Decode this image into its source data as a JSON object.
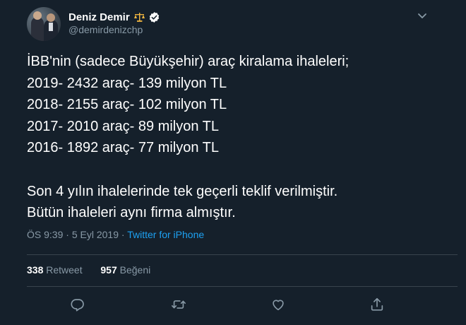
{
  "tweet": {
    "display_name": "Deniz Demir",
    "handle": "@demirdenizchp",
    "text_lines": [
      "İBB'nin (sadece Büyükşehir) araç kiralama ihaleleri;",
      "2019- 2432 araç- 139 milyon TL",
      "2018- 2155 araç- 102 milyon TL",
      "2017- 2010 araç- 89 milyon TL",
      "2016- 1892 araç- 77 milyon TL",
      "Son 4 yılın ihalelerinde tek geçerli teklif verilmiştir.",
      "Bütün ihaleleri aynı firma almıştır."
    ],
    "time": "ÖS 9:39",
    "separator": "·",
    "date": "5 Eyl 2019",
    "source": "Twitter for iPhone",
    "retweet_count": "338",
    "retweet_label": "Retweet",
    "like_count": "957",
    "like_label": "Beğeni"
  },
  "icons": {
    "name_badge": "scale-icon",
    "verified": "verified-badge-icon",
    "menu": "chevron-down-icon",
    "reply": "reply-icon",
    "retweet": "retweet-icon",
    "like": "heart-icon",
    "share": "share-icon"
  },
  "colors": {
    "background": "#15202b",
    "primary_text": "#ffffff",
    "secondary_text": "#8899a6",
    "link": "#1da1f2",
    "divider": "#38444d"
  }
}
